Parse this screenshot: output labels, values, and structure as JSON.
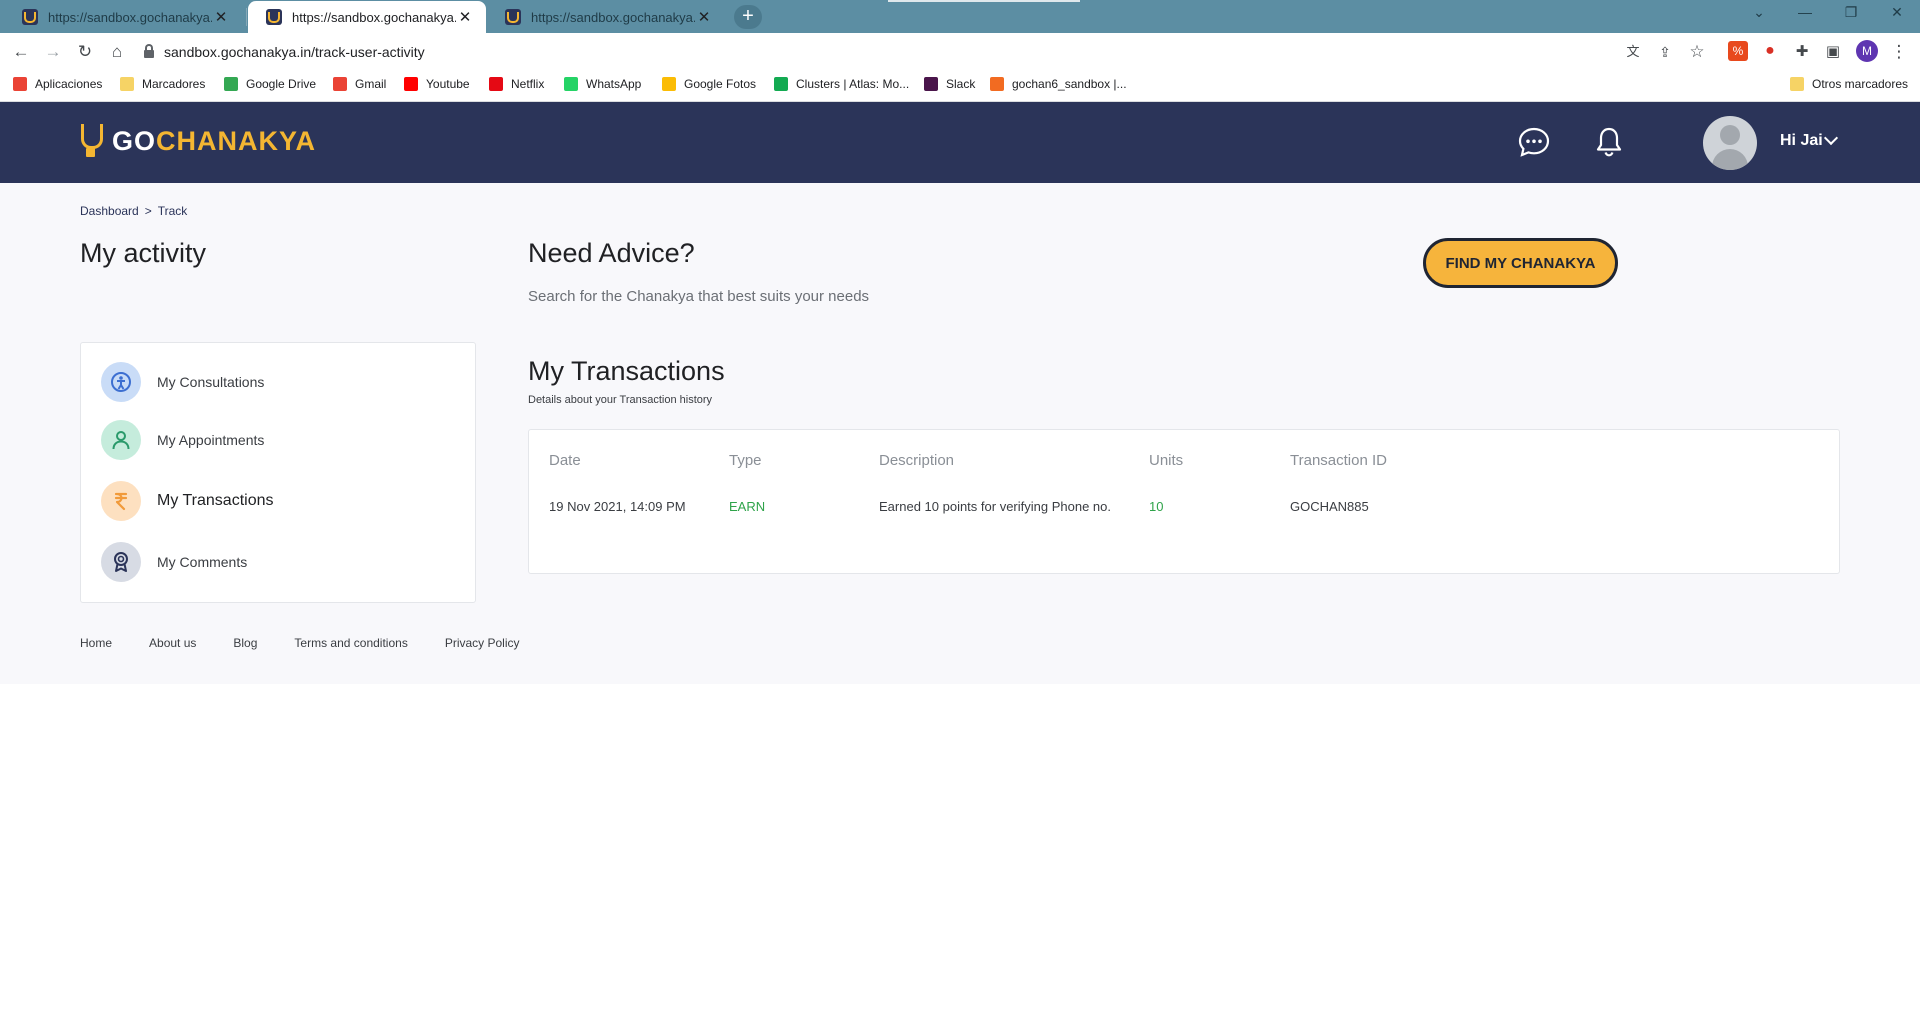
{
  "browser": {
    "tabs": [
      {
        "title": "https://sandbox.gochanakya.in/e",
        "close": "✕"
      },
      {
        "title": "https://sandbox.gochanakya.in/t",
        "close": "✕"
      },
      {
        "title": "https://sandbox.gochanakya.in/w",
        "close": "✕"
      }
    ],
    "new_tab": "+",
    "url": "sandbox.gochanakya.in/track-user-activity",
    "profile_initial": "M",
    "bookmarks": [
      {
        "label": "Aplicaciones",
        "color": "#ea4335"
      },
      {
        "label": "Marcadores",
        "color": "#f6d365"
      },
      {
        "label": "Google Drive",
        "color": "#34a853"
      },
      {
        "label": "Gmail",
        "color": "#ea4335"
      },
      {
        "label": "Youtube",
        "color": "#ff0000"
      },
      {
        "label": "Netflix",
        "color": "#e50914"
      },
      {
        "label": "WhatsApp",
        "color": "#25d366"
      },
      {
        "label": "Google Fotos",
        "color": "#fbbc05"
      },
      {
        "label": "Clusters | Atlas: Mo...",
        "color": "#13aa52"
      },
      {
        "label": "Slack",
        "color": "#4a154b"
      },
      {
        "label": "gochan6_sandbox |...",
        "color": "#f26b21"
      }
    ],
    "other_bookmarks": "Otros marcadores"
  },
  "header": {
    "logo_go": "GO",
    "logo_rest": "CHANAKYA",
    "greeting": "Hi Jai"
  },
  "breadcrumb": [
    "Dashboard",
    ">",
    "Track"
  ],
  "page_title": "My activity",
  "advice": {
    "title": "Need Advice?",
    "subtitle": "Search for the Chanakya that best suits your needs",
    "button": "FIND MY CHANAKYA"
  },
  "sidebar": {
    "items": [
      {
        "label": "My Consultations",
        "icon": "consultation-icon",
        "bg": "#c9dcf7",
        "fg": "#3d6fd1"
      },
      {
        "label": "My Appointments",
        "icon": "person-icon",
        "bg": "#c5ecdc",
        "fg": "#2a9a6b"
      },
      {
        "label": "My Transactions",
        "icon": "rupee-icon",
        "bg": "#fde0c0",
        "fg": "#f19a3a"
      },
      {
        "label": "My Comments",
        "icon": "badge-icon",
        "bg": "#d7dbe4",
        "fg": "#2b3459"
      }
    ],
    "active_index": 2
  },
  "transactions": {
    "title": "My Transactions",
    "subtitle": "Details about your Transaction history",
    "columns": [
      "Date",
      "Type",
      "Description",
      "Units",
      "Transaction ID"
    ],
    "rows": [
      {
        "date": "19 Nov 2021, 14:09 PM",
        "type": "EARN",
        "description": "Earned 10 points for verifying Phone no.",
        "units": "10",
        "id": "GOCHAN885"
      }
    ]
  },
  "footer": [
    "Home",
    "About us",
    "Blog",
    "Terms and conditions",
    "Privacy Policy"
  ],
  "colors": {
    "navbar": "#2b3459",
    "brand_accent": "#f4b632",
    "button": "#f6b43c",
    "earn_green": "#2fa34a"
  }
}
